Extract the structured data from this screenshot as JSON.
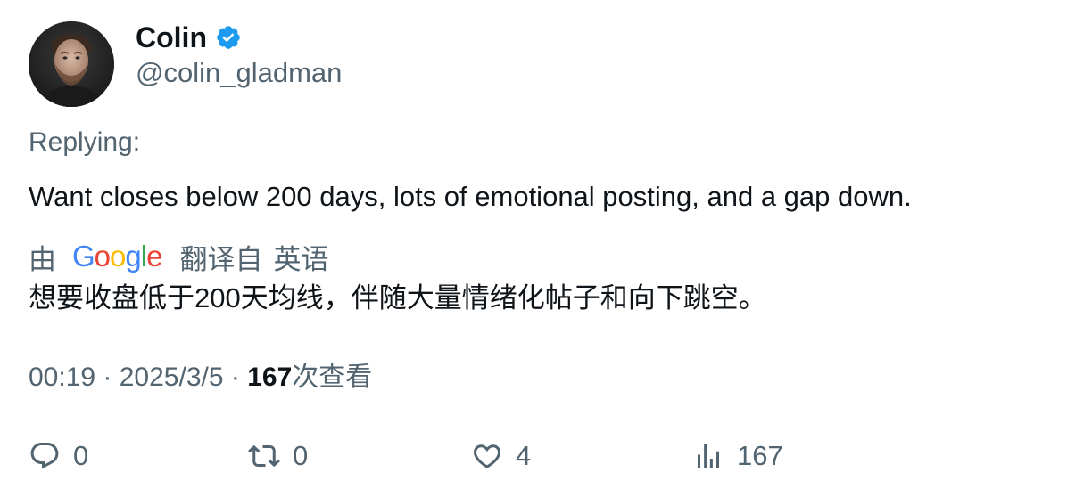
{
  "author": {
    "display_name": "Colin",
    "handle": "@colin_gladman",
    "verified": true,
    "verified_color": "#1d9bf0"
  },
  "replying_label": "Replying:",
  "tweet_text": "Want closes below 200 days, lots of emotional posting, and a gap down.",
  "translation": {
    "prefix": "由",
    "provider": "Google",
    "provider_letter_colors": [
      "#4285f4",
      "#ea4335",
      "#fbbc05",
      "#4285f4",
      "#34a853",
      "#ea4335"
    ],
    "label": "翻译自",
    "source_language": "英语",
    "translated_text": "想要收盘低于200天均线，伴随大量情绪化帖子和向下跳空。"
  },
  "meta": {
    "time": "00:19",
    "separator": " · ",
    "date": "2025/3/5",
    "views_count": "167",
    "views_label": "次查看"
  },
  "actions": {
    "reply_count": "0",
    "retweet_count": "0",
    "like_count": "4",
    "views_count": "167"
  },
  "colors": {
    "text_primary": "#0f1419",
    "text_secondary": "#536471"
  }
}
